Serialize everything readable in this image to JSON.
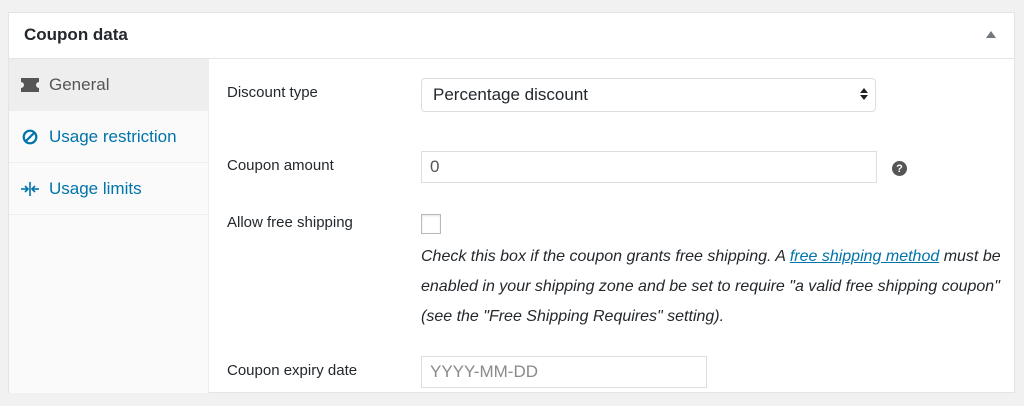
{
  "panel": {
    "title": "Coupon data"
  },
  "tabs": [
    {
      "label": "General",
      "icon": "ticket-icon"
    },
    {
      "label": "Usage restriction",
      "icon": "block-icon"
    },
    {
      "label": "Usage limits",
      "icon": "limits-icon"
    }
  ],
  "fields": {
    "discount_type": {
      "label": "Discount type",
      "value": "Percentage discount"
    },
    "coupon_amount": {
      "label": "Coupon amount",
      "value": "0"
    },
    "free_shipping": {
      "label": "Allow free shipping",
      "desc_before": "Check this box if the coupon grants free shipping. A ",
      "link_text": "free shipping method",
      "desc_after": " must be enabled in your shipping zone and be set to require \"a valid free shipping coupon\" (see the \"Free Shipping Requires\" setting)."
    },
    "expiry_date": {
      "label": "Coupon expiry date",
      "placeholder": "YYYY-MM-DD"
    }
  },
  "help_icon": "?",
  "colors": {
    "link": "#0073aa",
    "active_tab_bg": "#eeeeee",
    "sidebar_bg": "#fafafa"
  }
}
